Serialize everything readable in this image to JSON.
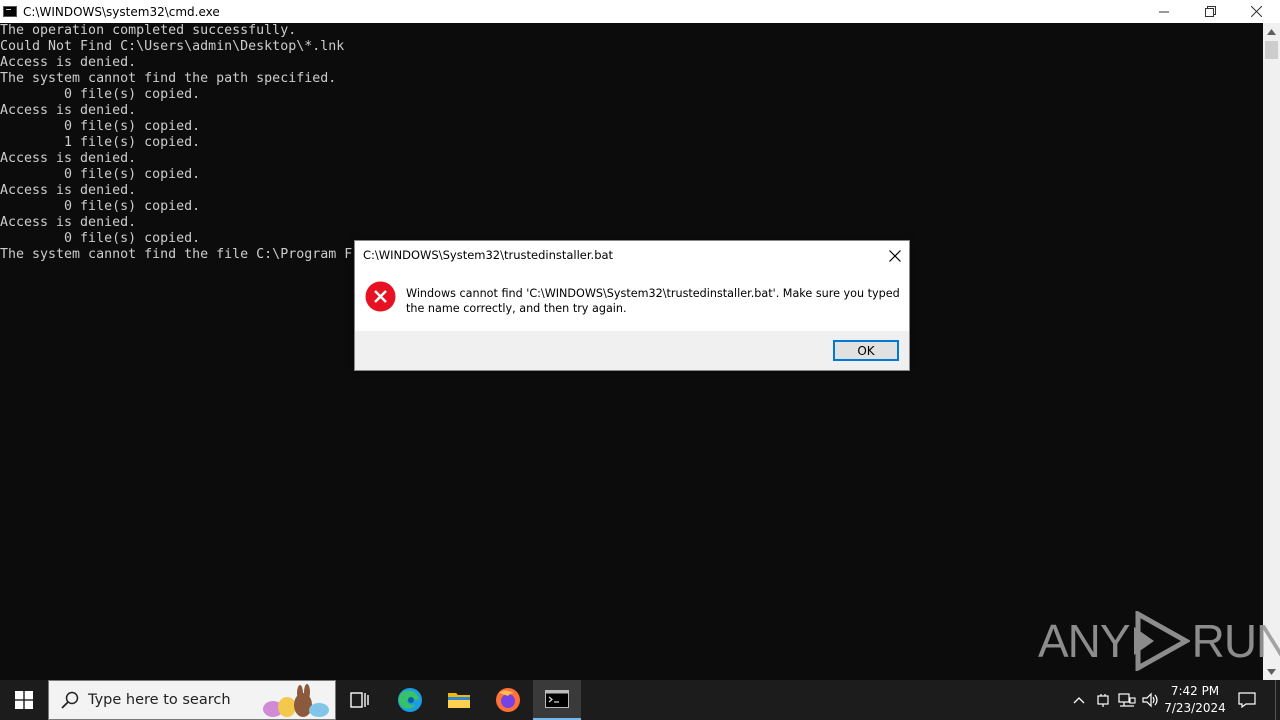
{
  "window": {
    "title": "C:\\WINDOWS\\system32\\cmd.exe"
  },
  "console": {
    "lines": [
      "The operation completed successfully.",
      "Could Not Find C:\\Users\\admin\\Desktop\\*.lnk",
      "Access is denied.",
      "The system cannot find the path specified.",
      "        0 file(s) copied.",
      "Access is denied.",
      "        0 file(s) copied.",
      "        1 file(s) copied.",
      "Access is denied.",
      "        0 file(s) copied.",
      "Access is denied.",
      "        0 file(s) copied.",
      "Access is denied.",
      "        0 file(s) copied.",
      "The system cannot find the file C:\\Program F"
    ]
  },
  "dialog": {
    "title": "C:\\WINDOWS\\System32\\trustedinstaller.bat",
    "message": "Windows cannot find 'C:\\WINDOWS\\System32\\trustedinstaller.bat'. Make sure you typed the name correctly, and then try again.",
    "ok_label": "OK",
    "icon": "error-icon"
  },
  "watermark": {
    "left": "ANY",
    "right": "RUN"
  },
  "taskbar": {
    "search_placeholder": "Type here to search",
    "apps": [
      "task-view-icon",
      "edge-icon",
      "file-explorer-icon",
      "firefox-icon",
      "cmd-icon"
    ],
    "clock_time": "7:42 PM",
    "clock_date": "7/23/2024"
  },
  "colors": {
    "console_bg": "#0c0c0c",
    "console_text": "#cccccc",
    "accent": "#0078d7",
    "error_red": "#e81123",
    "taskbar_bg": "#1c1c1c"
  }
}
